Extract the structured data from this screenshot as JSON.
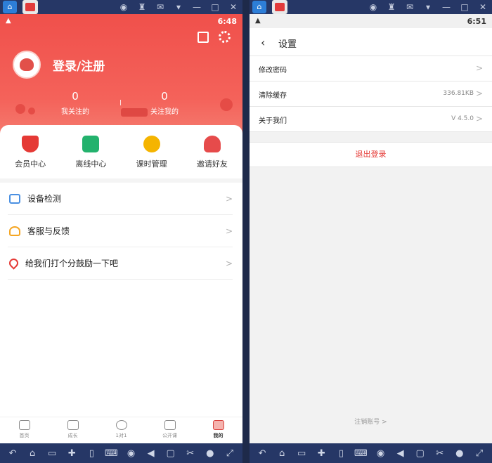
{
  "left": {
    "status": {
      "time": "6:48",
      "signal": "📶"
    },
    "profile": {
      "login_label": "登录/注册"
    },
    "stats": [
      {
        "count": "0",
        "label": "我关注的"
      },
      {
        "count": "0",
        "label": "关注我的"
      }
    ],
    "quick": [
      {
        "label": "会员中心",
        "color": "#e53935"
      },
      {
        "label": "离线中心",
        "color": "#23b26d"
      },
      {
        "label": "课时管理",
        "color": "#f5b400"
      },
      {
        "label": "邀请好友",
        "color": "#e64b4b"
      }
    ],
    "menu": [
      {
        "label": "设备检测",
        "icon": "router-icon",
        "color": "#4a90e2"
      },
      {
        "label": "客服与反馈",
        "icon": "headset-icon",
        "color": "#f5a623"
      },
      {
        "label": "给我们打个分鼓励一下吧",
        "icon": "heart-icon",
        "color": "#e53935"
      }
    ],
    "tabs": [
      {
        "label": "首页",
        "active": false
      },
      {
        "label": "成长",
        "active": false
      },
      {
        "label": "1对1",
        "active": false
      },
      {
        "label": "公开课",
        "active": false
      },
      {
        "label": "我的",
        "active": true
      }
    ]
  },
  "right": {
    "status": {
      "time": "6:51"
    },
    "header": {
      "title": "设置"
    },
    "rows": [
      {
        "label": "修改密码",
        "value": ""
      },
      {
        "label": "清除缓存",
        "value": "336.81KB"
      },
      {
        "label": "关于我们",
        "value": "V 4.5.0"
      }
    ],
    "logout": "退出登录",
    "cancel_account": "注销账号 >"
  },
  "chevron": ">"
}
